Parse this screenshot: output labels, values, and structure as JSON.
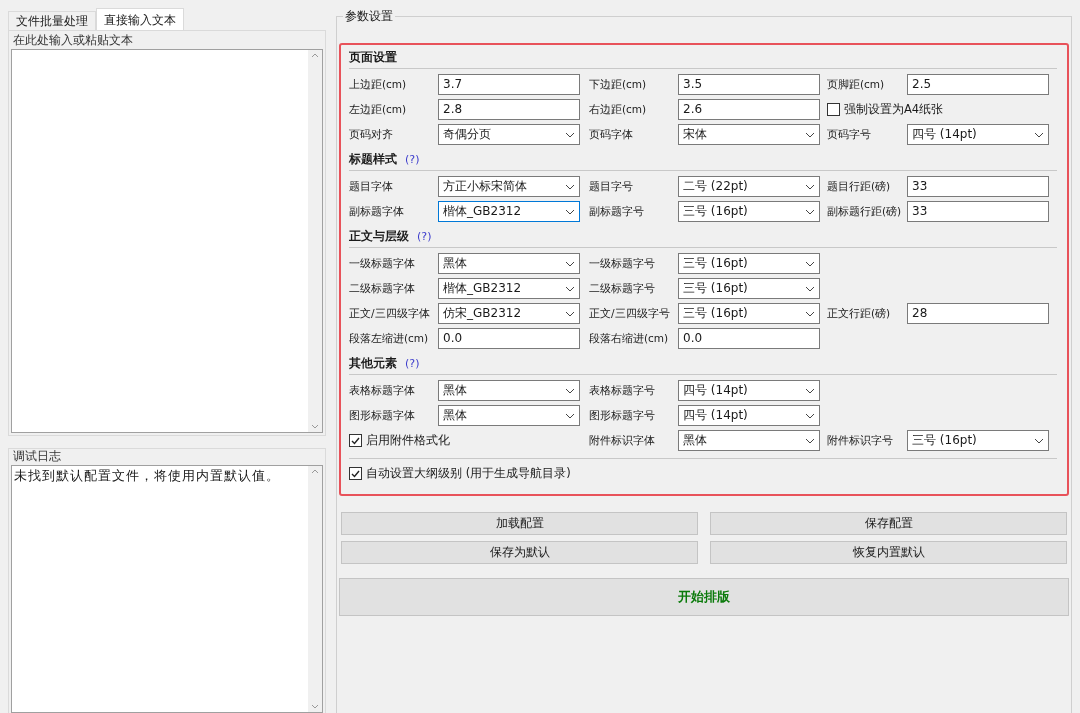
{
  "left_tabs": [
    {
      "label": "文件批量处理",
      "selected": false
    },
    {
      "label": "直接输入文本",
      "selected": true
    }
  ],
  "input_group": {
    "title": "在此处输入或粘贴文本"
  },
  "log_group": {
    "title": "调试日志",
    "lines": [
      "未找到默认配置文件，将使用内置默认值。"
    ]
  },
  "settings": {
    "title": "参数设置",
    "sections": [
      {
        "title": "页面设置",
        "rows": [
          [
            {
              "kind": "text",
              "label": "上边距(cm)",
              "value": "3.7",
              "focused": false
            },
            {
              "kind": "text",
              "label": "下边距(cm)",
              "value": "3.5",
              "focused": false
            },
            {
              "kind": "text",
              "label": "页脚距(cm)",
              "value": "2.5",
              "focused": false
            }
          ],
          [
            {
              "kind": "text",
              "label": "左边距(cm)",
              "value": "2.8",
              "focused": false
            },
            {
              "kind": "text",
              "label": "右边距(cm)",
              "value": "2.6",
              "focused": false
            },
            {
              "kind": "checkbox",
              "label": "强制设置为A4纸张",
              "checked": false
            }
          ],
          [
            {
              "kind": "select",
              "label": "页码对齐",
              "value": "奇偶分页",
              "focused": false
            },
            {
              "kind": "select",
              "label": "页码字体",
              "value": "宋体",
              "focused": false
            },
            {
              "kind": "select",
              "label": "页码字号",
              "value": "四号 (14pt)",
              "focused": false
            }
          ]
        ]
      },
      {
        "title": "标题样式",
        "help_text": "(?)",
        "rows": [
          [
            {
              "kind": "select",
              "label": "题目字体",
              "value": "方正小标宋简体",
              "focused": false
            },
            {
              "kind": "select",
              "label": "题目字号",
              "value": "二号 (22pt)",
              "focused": false
            },
            {
              "kind": "text",
              "label": "题目行距(磅)",
              "value": "33",
              "focused": false
            }
          ],
          [
            {
              "kind": "select",
              "label": "副标题字体",
              "value": "楷体_GB2312",
              "focused": true
            },
            {
              "kind": "select",
              "label": "副标题字号",
              "value": "三号 (16pt)",
              "focused": false
            },
            {
              "kind": "text",
              "label": "副标题行距(磅)",
              "value": "33",
              "focused": false
            }
          ]
        ]
      },
      {
        "title": "正文与层级",
        "help_text": "(?)",
        "rows": [
          [
            {
              "kind": "select",
              "label": "一级标题字体",
              "value": "黑体",
              "focused": false
            },
            {
              "kind": "select",
              "label": "一级标题字号",
              "value": "三号 (16pt)",
              "focused": false
            },
            {
              "kind": "blank"
            }
          ],
          [
            {
              "kind": "select",
              "label": "二级标题字体",
              "value": "楷体_GB2312",
              "focused": false
            },
            {
              "kind": "select",
              "label": "二级标题字号",
              "value": "三号 (16pt)",
              "focused": false
            },
            {
              "kind": "blank"
            }
          ],
          [
            {
              "kind": "select",
              "label": "正文/三四级字体",
              "value": "仿宋_GB2312",
              "focused": false
            },
            {
              "kind": "select",
              "label": "正文/三四级字号",
              "value": "三号 (16pt)",
              "focused": false
            },
            {
              "kind": "text",
              "label": "正文行距(磅)",
              "value": "28",
              "focused": false
            }
          ],
          [
            {
              "kind": "text",
              "label": "段落左缩进(cm)",
              "value": "0.0",
              "focused": false
            },
            {
              "kind": "text",
              "label": "段落右缩进(cm)",
              "value": "0.0",
              "focused": false
            },
            {
              "kind": "blank"
            }
          ]
        ]
      },
      {
        "title": "其他元素",
        "help_text": "(?)",
        "rows": [
          [
            {
              "kind": "select",
              "label": "表格标题字体",
              "value": "黑体",
              "focused": false
            },
            {
              "kind": "select",
              "label": "表格标题字号",
              "value": "四号 (14pt)",
              "focused": false
            },
            {
              "kind": "blank"
            }
          ],
          [
            {
              "kind": "select",
              "label": "图形标题字体",
              "value": "黑体",
              "focused": false
            },
            {
              "kind": "select",
              "label": "图形标题字号",
              "value": "四号 (14pt)",
              "focused": false
            },
            {
              "kind": "blank"
            }
          ],
          [
            {
              "kind": "checkbox",
              "label": "启用附件格式化",
              "checked": true
            },
            {
              "kind": "select",
              "label": "附件标识字体",
              "value": "黑体",
              "focused": false
            },
            {
              "kind": "select",
              "label": "附件标识字号",
              "value": "三号 (16pt)",
              "focused": false
            }
          ]
        ]
      }
    ],
    "outline_option": {
      "label": "自动设置大纲级别 (用于生成导航目录)",
      "checked": true
    }
  },
  "buttons": [
    {
      "label": "加载配置"
    },
    {
      "label": "保存配置"
    },
    {
      "label": "保存为默认"
    },
    {
      "label": "恢复内置默认"
    }
  ],
  "start_button": {
    "label": "开始排版"
  }
}
